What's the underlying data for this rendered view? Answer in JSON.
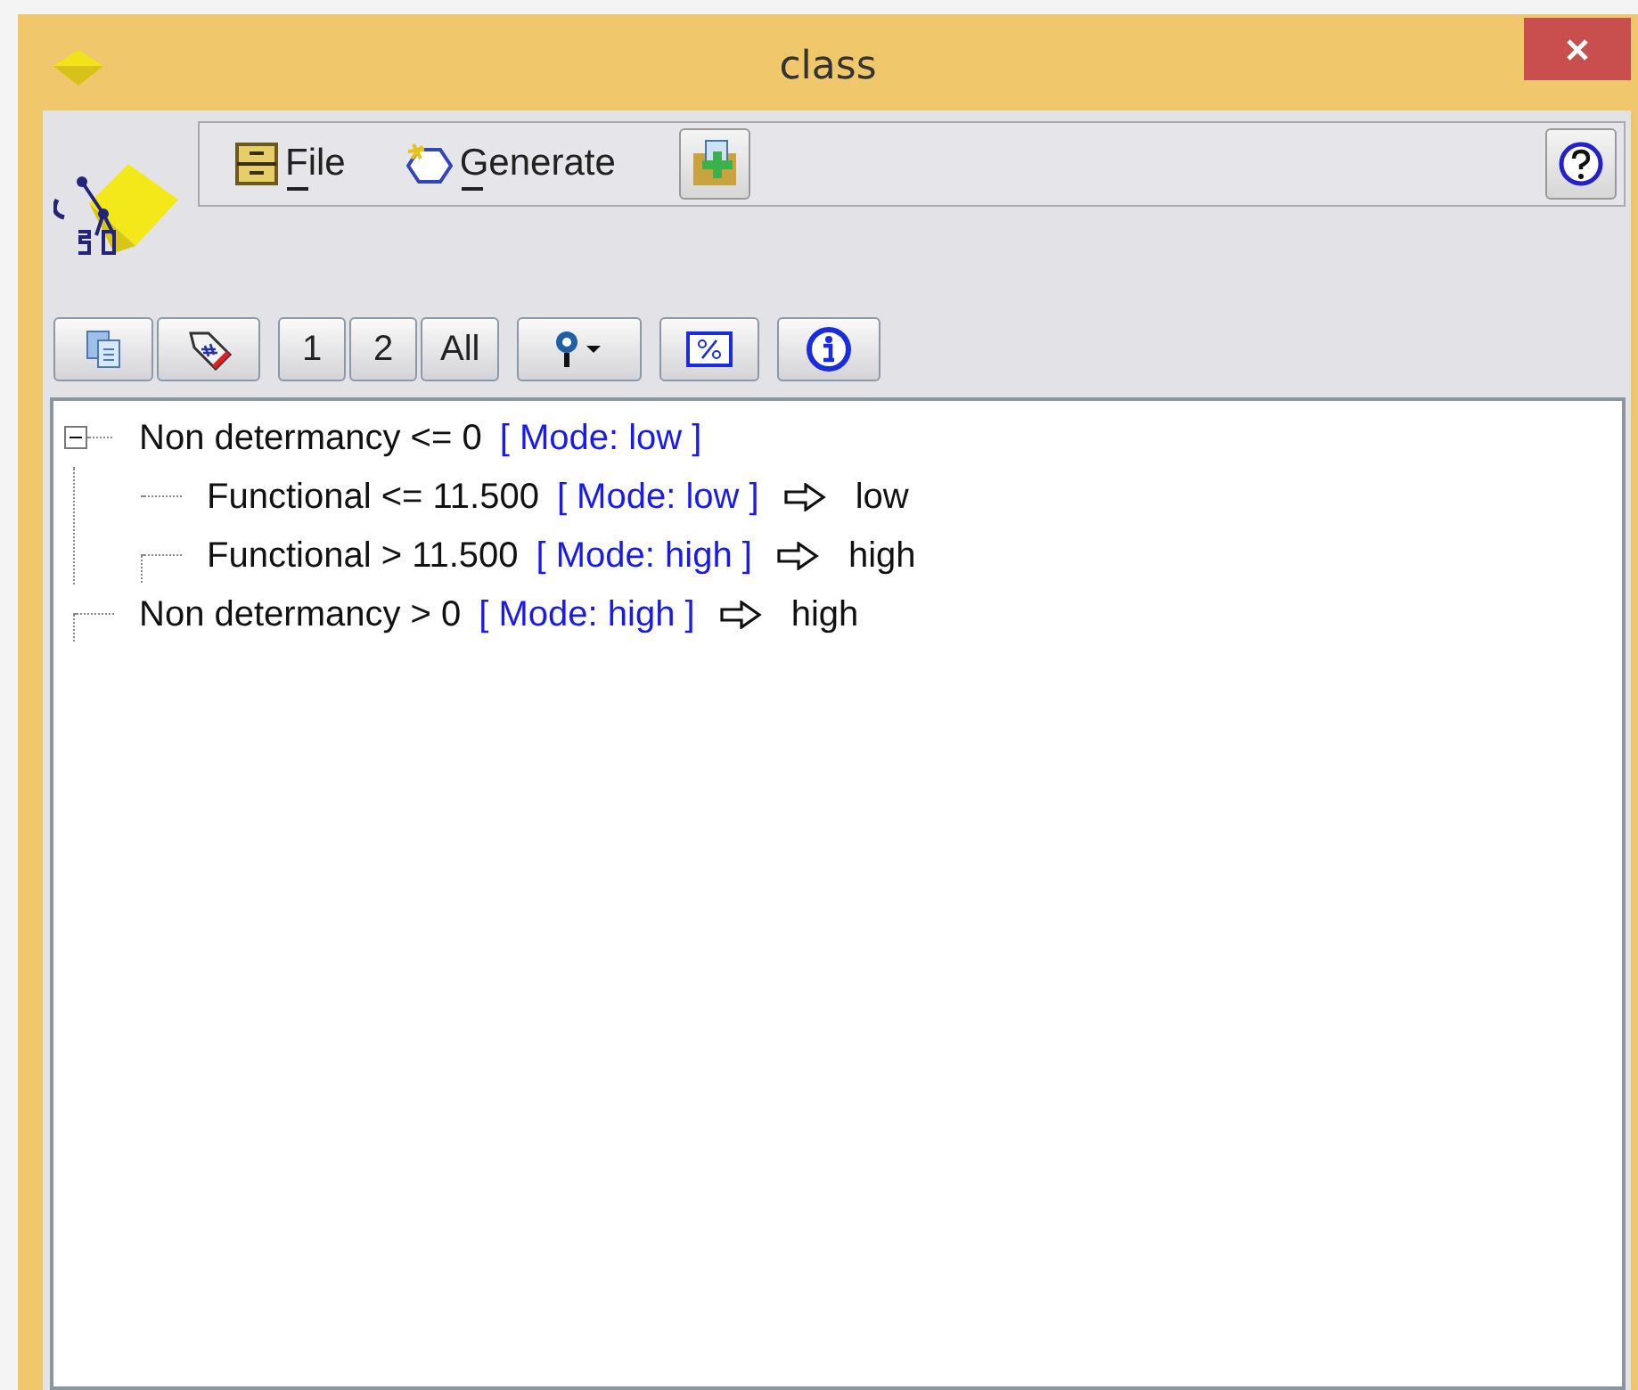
{
  "window": {
    "title": "class"
  },
  "menu": [
    {
      "label": "File",
      "kind": "file"
    },
    {
      "label": "Generate",
      "kind": "generate"
    }
  ],
  "toolbar": [
    {
      "kind": "copy"
    },
    {
      "kind": "tag"
    },
    {
      "kind": "text",
      "label": "1"
    },
    {
      "kind": "text",
      "label": "2"
    },
    {
      "kind": "text",
      "label": "All"
    },
    {
      "kind": "pin"
    },
    {
      "kind": "percent"
    },
    {
      "kind": "info"
    }
  ],
  "tree": [
    {
      "condition": "Non determancy <= 0",
      "mode": "[ Mode: low ]",
      "expanded": true,
      "children": [
        {
          "condition": "Functional <= 11.500",
          "mode": "[ Mode: low ]",
          "outcome": "low"
        },
        {
          "condition": "Functional > 11.500",
          "mode": "[ Mode: high ]",
          "outcome": "high"
        }
      ]
    },
    {
      "condition": "Non determancy > 0",
      "mode": "[ Mode: high ]",
      "outcome": "high"
    }
  ]
}
